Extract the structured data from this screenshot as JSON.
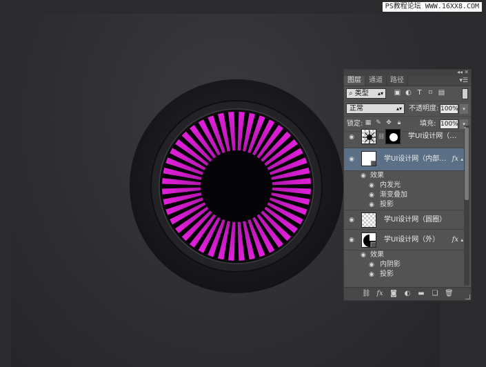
{
  "watermark": "PS教程论坛 WWW.16XX8.COM",
  "artwork": {
    "ring_color": "#1a191c",
    "accent": "#c81ec3",
    "ray_color": "#000000",
    "ray_count": 44
  },
  "panel": {
    "tabs": [
      "图层",
      "通道",
      "路径"
    ],
    "filter": {
      "label": "类型",
      "icons": [
        "image-filter-icon",
        "adjustment-filter-icon",
        "type-filter-icon",
        "shape-filter-icon",
        "smart-object-filter-icon"
      ]
    },
    "blend": {
      "mode": "正常",
      "opacity_label": "不透明度:",
      "opacity": "100%"
    },
    "lock": {
      "label": "锁定:",
      "fill_label": "填充:",
      "fill": "100%"
    },
    "layers": [
      {
        "name": "学UI设计网（…",
        "thumb": "masked-rays",
        "mask": true,
        "fx": false,
        "selected": false
      },
      {
        "name": "学UI设计网（内部…",
        "thumb": "white-disc",
        "mask": false,
        "fx": true,
        "selected": true,
        "effects_label": "效果",
        "effects": [
          "内发光",
          "渐变叠加",
          "投影"
        ]
      },
      {
        "name": "学UI设计网（圆圈）",
        "thumb": "transparent",
        "mask": false,
        "fx": false,
        "selected": false
      },
      {
        "name": "学UI设计网（外）",
        "thumb": "black-disc",
        "mask": false,
        "fx": true,
        "selected": false,
        "effects_label": "效果",
        "effects": [
          "内阴影",
          "投影"
        ]
      }
    ],
    "fx_label": "fx"
  }
}
